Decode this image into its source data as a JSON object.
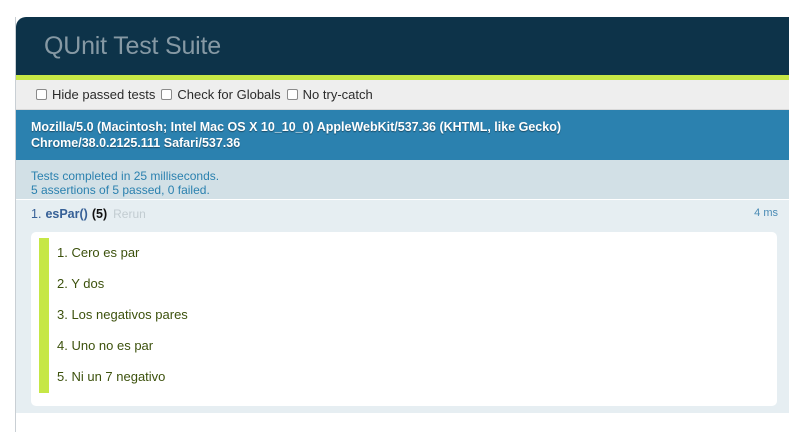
{
  "header": {
    "title": "QUnit Test Suite"
  },
  "toolbar": {
    "options": [
      {
        "label": "Hide passed tests",
        "checked": false
      },
      {
        "label": "Check for Globals",
        "checked": false
      },
      {
        "label": "No try-catch",
        "checked": false
      }
    ]
  },
  "user_agent": {
    "line1": "Mozilla/5.0 (Macintosh; Intel Mac OS X 10_10_0) AppleWebKit/537.36 (KHTML, like Gecko)",
    "line2": "Chrome/38.0.2125.111 Safari/537.36"
  },
  "result": {
    "line1": "Tests completed in 25 milliseconds.",
    "line2": "5 assertions of 5 passed, 0 failed."
  },
  "test": {
    "number": "1.",
    "name": "esPar()",
    "count": "(5)",
    "rerun_label": "Rerun",
    "runtime": "4 ms",
    "assertions": [
      "1. Cero es par",
      "2. Y dos",
      "3. Los negativos pares",
      "4. Uno no es par",
      "5. Ni un 7 negativo"
    ]
  },
  "colors": {
    "header_bg": "#0d3349",
    "banner_pass": "#c6e746",
    "user_agent_bg": "#2b81af",
    "result_bg": "#d2e0e6",
    "pass_text": "#3c510c"
  }
}
